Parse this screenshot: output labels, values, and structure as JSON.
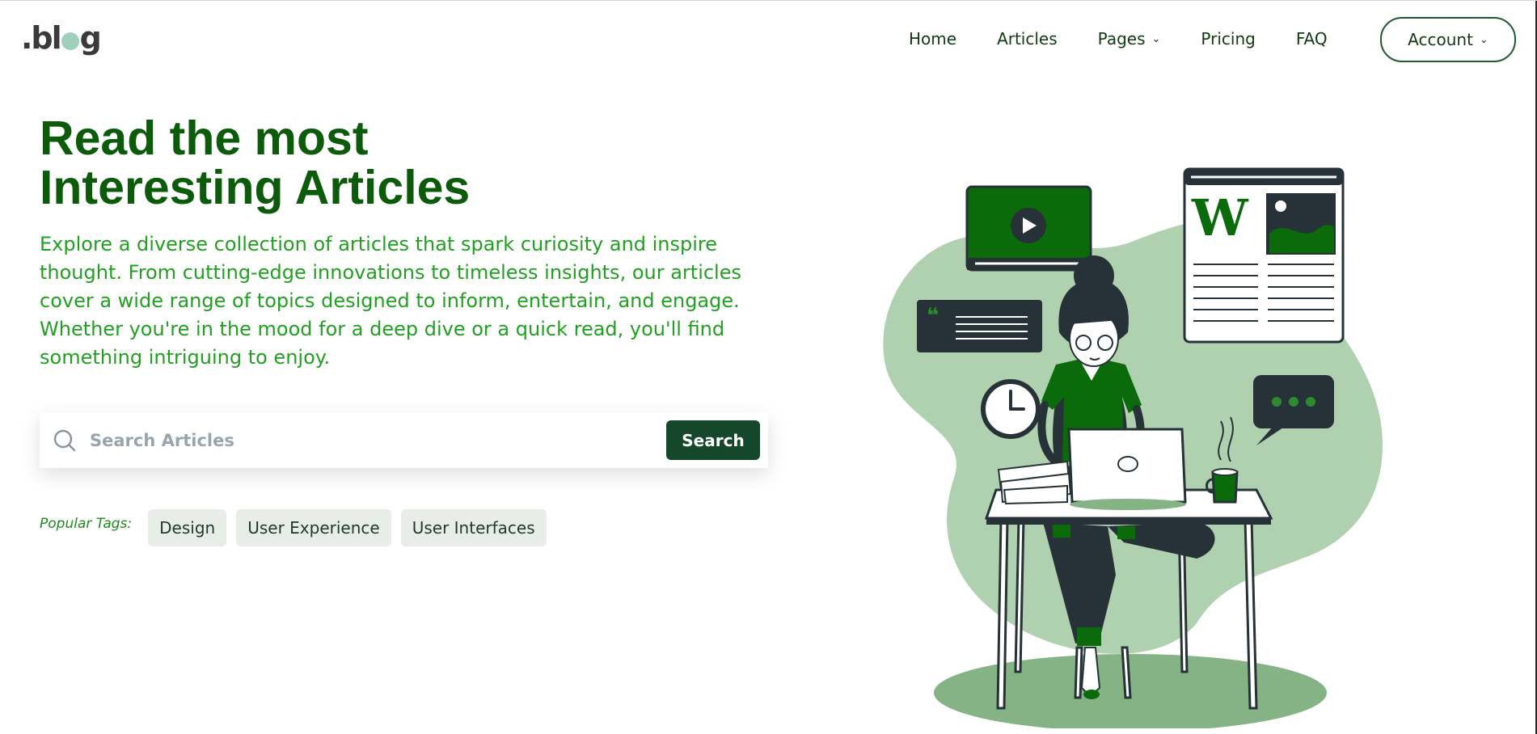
{
  "logo": {
    "prefix": ".bl",
    "suffix": "g"
  },
  "nav": {
    "items": [
      {
        "label": "Home"
      },
      {
        "label": "Articles"
      },
      {
        "label": "Pages",
        "dropdown": true
      },
      {
        "label": "Pricing"
      },
      {
        "label": "FAQ"
      }
    ],
    "account_label": "Account"
  },
  "hero": {
    "title_line1": "Read the most",
    "title_line2": "Interesting Articles",
    "description": "Explore a diverse collection of articles that spark curiosity and inspire thought. From cutting-edge innovations to timeless insights, our articles cover a wide range of topics designed to inform, entertain, and engage. Whether you're in the mood for a deep dive or a quick read, you'll find something intriguing to enjoy."
  },
  "search": {
    "placeholder": "Search Articles",
    "value": "",
    "button_label": "Search"
  },
  "tags": {
    "label": "Popular Tags:",
    "items": [
      "Design",
      "User Experience",
      "User Interfaces"
    ]
  },
  "illustration": {
    "article_letter": "W"
  },
  "colors": {
    "brand_dark_green": "#0b5b0b",
    "text_green": "#22a022",
    "button_green": "#15472a",
    "blob_green": "#b0d1b0",
    "shadow_green": "#86b386",
    "dark_slate": "#263238"
  }
}
